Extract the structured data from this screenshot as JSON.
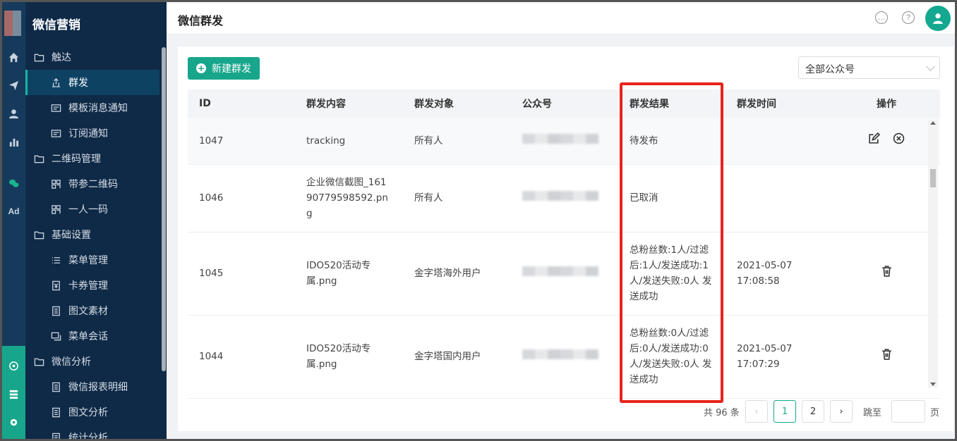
{
  "sidebar": {
    "brand": "微信营销",
    "groups": [
      {
        "label": "触达",
        "items": [
          "群发",
          "模板消息通知",
          "订阅通知"
        ]
      },
      {
        "label": "二维码管理",
        "items": [
          "带参二维码",
          "一人一码"
        ]
      },
      {
        "label": "基础设置",
        "items": [
          "菜单管理",
          "卡券管理",
          "图文素材",
          "菜单会话"
        ]
      },
      {
        "label": "微信分析",
        "items": [
          "微信报表明细",
          "图文分析",
          "统计分析"
        ]
      }
    ],
    "active_item": "群发",
    "rail_ad": "Ad"
  },
  "header": {
    "title": "微信群发",
    "chat_icon": "chat-bubble-icon",
    "help_icon": "help-circle-icon",
    "avatar_icon": "user-icon"
  },
  "toolbar": {
    "new_button": "新建群发",
    "account_select": "全部公众号"
  },
  "table": {
    "columns": [
      "ID",
      "群发内容",
      "群发对象",
      "公众号",
      "群发结果",
      "群发时间",
      "操作"
    ],
    "rows": [
      {
        "id": "1047",
        "content": "tracking",
        "target": "所有人",
        "result": "待发布",
        "time": "",
        "actions": [
          "edit",
          "cancel"
        ]
      },
      {
        "id": "1046",
        "content": "企业微信截图_16190779598592.png",
        "target": "所有人",
        "result": "已取消",
        "time": "",
        "actions": []
      },
      {
        "id": "1045",
        "content": "IDO520活动专属.png",
        "target": "金字塔海外用户",
        "result": "总粉丝数:1人/过滤后:1人/发送成功:1人/发送失败:0人 发送成功",
        "time": "2021-05-07 17:08:58",
        "actions": [
          "delete"
        ]
      },
      {
        "id": "1044",
        "content": "IDO520活动专属.png",
        "target": "金字塔国内用户",
        "result": "总粉丝数:0人/过滤后:0人/发送成功:0人/发送失败:0人 发送成功",
        "time": "2021-05-07 17:07:29",
        "actions": [
          "delete"
        ]
      }
    ]
  },
  "pagination": {
    "total_text": "共 96 条",
    "pages": [
      "1",
      "2"
    ],
    "current": "1",
    "jump_label": "跳至",
    "page_suffix": "页"
  },
  "colors": {
    "accent": "#17a68c",
    "sidebar_bg": "#0f2a47",
    "highlight": "#e8231c"
  }
}
